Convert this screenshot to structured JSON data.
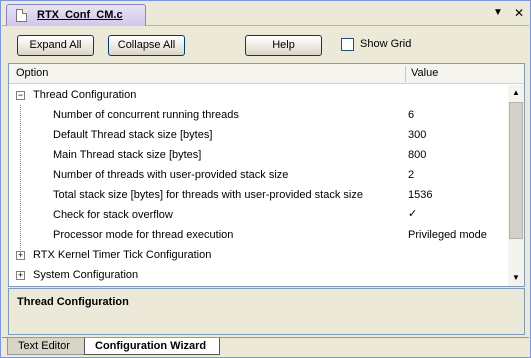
{
  "window": {
    "doc_tab": "RTX_Conf_CM.c",
    "icons": {
      "file": "file-icon",
      "dropdown": "dropdown-icon",
      "close": "close-icon"
    }
  },
  "toolbar": {
    "expand_all": "Expand All",
    "collapse_all": "Collapse All",
    "help": "Help",
    "show_grid": "Show Grid",
    "show_grid_checked": false
  },
  "grid": {
    "headers": {
      "option": "Option",
      "value": "Value"
    },
    "rows": [
      {
        "label": "Thread Configuration",
        "value": "",
        "type": "group",
        "expanded": true
      },
      {
        "label": "Number of concurrent running threads",
        "value": "6",
        "type": "child"
      },
      {
        "label": "Default Thread stack size [bytes]",
        "value": "300",
        "type": "child"
      },
      {
        "label": "Main Thread stack size [bytes]",
        "value": "800",
        "type": "child"
      },
      {
        "label": "Number of threads with user-provided stack size",
        "value": "2",
        "type": "child"
      },
      {
        "label": "Total stack size [bytes] for threads with user-provided stack size",
        "value": "1536",
        "type": "child"
      },
      {
        "label": "Check for stack overflow",
        "value": "✓",
        "type": "child-check",
        "checked": true
      },
      {
        "label": "Processor mode for thread execution",
        "value": "Privileged mode",
        "type": "child"
      },
      {
        "label": "RTX Kernel Timer Tick Configuration",
        "value": "",
        "type": "group",
        "expanded": false
      },
      {
        "label": "System Configuration",
        "value": "",
        "type": "group",
        "expanded": false
      }
    ],
    "expander_symbols": {
      "expanded": "−",
      "collapsed": "+"
    }
  },
  "description": {
    "title": "Thread Configuration"
  },
  "bottom_tabs": [
    {
      "label": "Text Editor",
      "active": false
    },
    {
      "label": "Configuration Wizard",
      "active": true
    }
  ]
}
